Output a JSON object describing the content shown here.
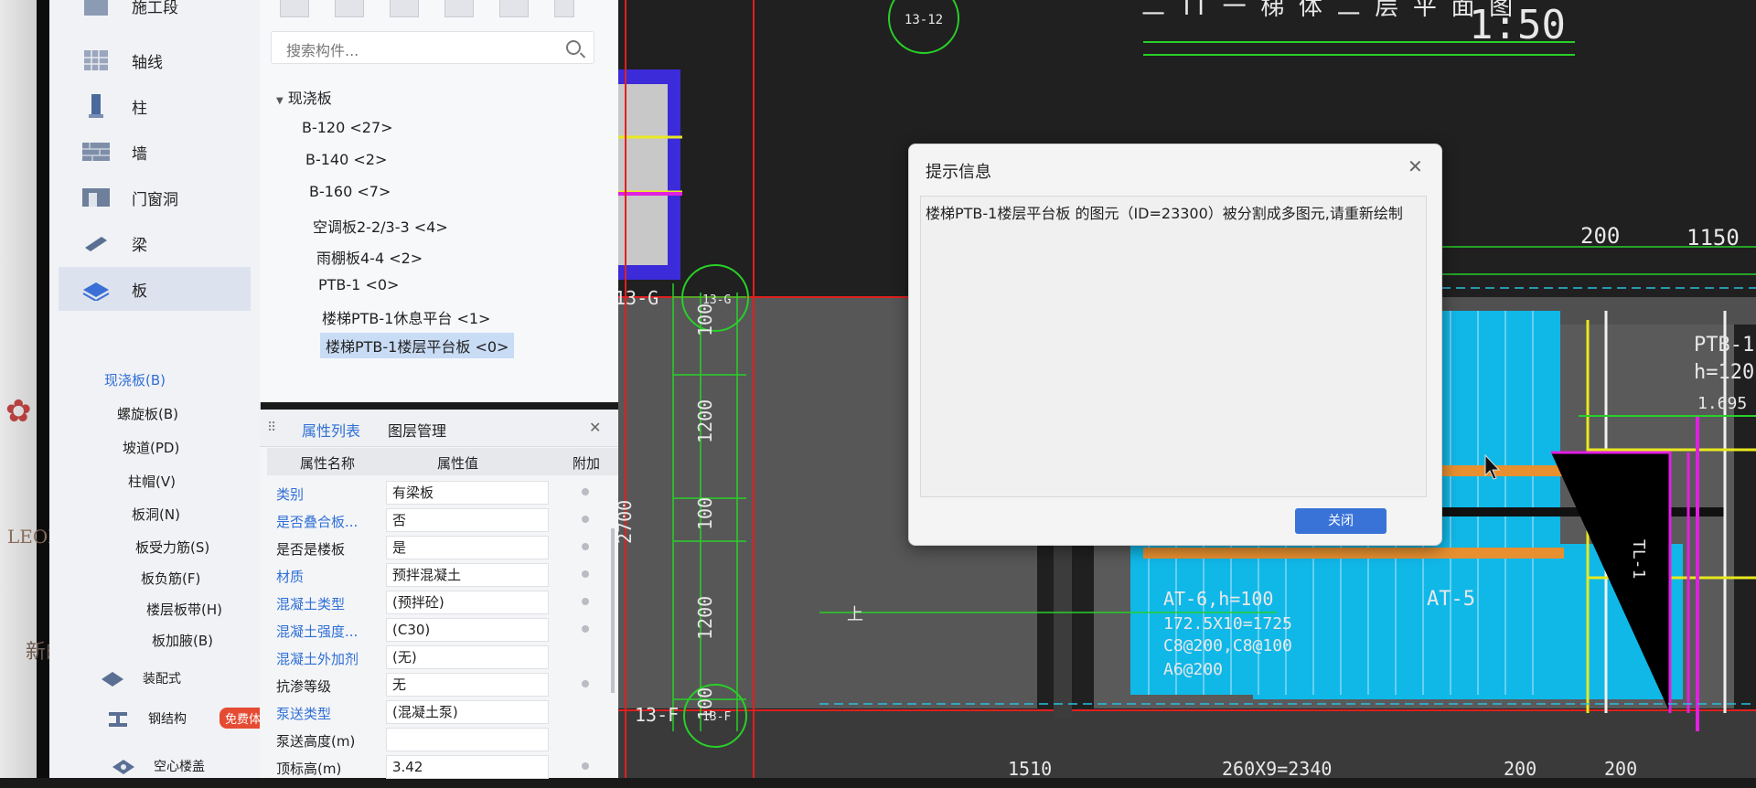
{
  "environment": {
    "bg_text_1": "LEONA",
    "bg_text_2": "新的一"
  },
  "nav": {
    "items": [
      {
        "label": "施工段",
        "icon": "construction-section-icon"
      },
      {
        "label": "轴线",
        "icon": "grid-axis-icon"
      },
      {
        "label": "柱",
        "icon": "column-icon"
      },
      {
        "label": "墙",
        "icon": "wall-icon"
      },
      {
        "label": "门窗洞",
        "icon": "door-window-icon"
      },
      {
        "label": "梁",
        "icon": "beam-icon"
      },
      {
        "label": "板",
        "icon": "slab-icon"
      }
    ],
    "sub_items": [
      "现浇板(B)",
      "螺旋板(B)",
      "坡道(PD)",
      "柱帽(V)",
      "板洞(N)",
      "板受力筋(S)",
      "板负筋(F)",
      "楼层板带(H)",
      "板加腋(B)"
    ],
    "bottom_items": [
      {
        "label": "装配式",
        "icon": "prefab-icon"
      },
      {
        "label": "钢结构",
        "icon": "steel-structure-icon"
      },
      {
        "label": "空心楼盖",
        "icon": "hollow-floor-icon"
      }
    ],
    "badge": "免费体验"
  },
  "tree": {
    "search_placeholder": "搜索构件...",
    "root": "现浇板",
    "nodes": [
      "B-120 <27>",
      "B-140 <2>",
      "B-160 <7>",
      "空调板2-2/3-3 <4>",
      "雨棚板4-4 <2>",
      "PTB-1 <0>",
      "楼梯PTB-1休息平台 <1>",
      "楼梯PTB-1楼层平台板 <0>"
    ]
  },
  "props": {
    "tabs": [
      "属性列表",
      "图层管理"
    ],
    "columns": [
      "属性名称",
      "属性值",
      "附加"
    ],
    "rows": [
      {
        "name": "类别",
        "value": "有梁板"
      },
      {
        "name": "是否叠合板...",
        "value": "否"
      },
      {
        "name": "是否是楼板",
        "value": "是"
      },
      {
        "name": "材质",
        "value": "预拌混凝土"
      },
      {
        "name": "混凝土类型",
        "value": "(预拌砼)"
      },
      {
        "name": "混凝土强度...",
        "value": "(C30)"
      },
      {
        "name": "混凝土外加剂",
        "value": "(无)"
      },
      {
        "name": "抗渗等级",
        "value": "无"
      },
      {
        "name": "泵送类型",
        "value": "(混凝土泵)"
      },
      {
        "name": "泵送高度(m)",
        "value": ""
      },
      {
        "name": "顶标高(m)",
        "value": "3.42"
      }
    ]
  },
  "cad": {
    "title": "二 TT  一 梯 体 二 层 平 面 图",
    "scale": "1:50",
    "labels": {
      "axis_1312": "13-12",
      "axis_13g": "13-G",
      "axis_13g_circle": "13-G",
      "axis_13f": "13-F",
      "axis_13f_circle": "13-F",
      "dim_200": "200",
      "dim_1150": "1150",
      "dim_100a": "100",
      "dim_1200a": "1200",
      "dim_2700": "2700",
      "dim_100b": "100",
      "dim_1200b": "1200",
      "dim_100c": "100",
      "ptb_label": "PTB-1",
      "ptb_h": "h=120",
      "ptb_elev": "1.695",
      "tl1": "TL-1",
      "at6": "AT-6,h=100",
      "at6_2": "172.5X10=1725",
      "at6_3": "C8@200,C8@100",
      "at6_4": "A6@200",
      "at5": "AT-5",
      "dim_1510": "1510",
      "dim_260": "260X9=2340",
      "dim_bottom_200": "200",
      "dim_bottom_200b": "200",
      "up_mark": "上"
    }
  },
  "dialog": {
    "title": "提示信息",
    "message": "楼梯PTB-1楼层平台板 的图元（ID=23300）被分割成多图元,请重新绘制",
    "button": "关闭"
  }
}
